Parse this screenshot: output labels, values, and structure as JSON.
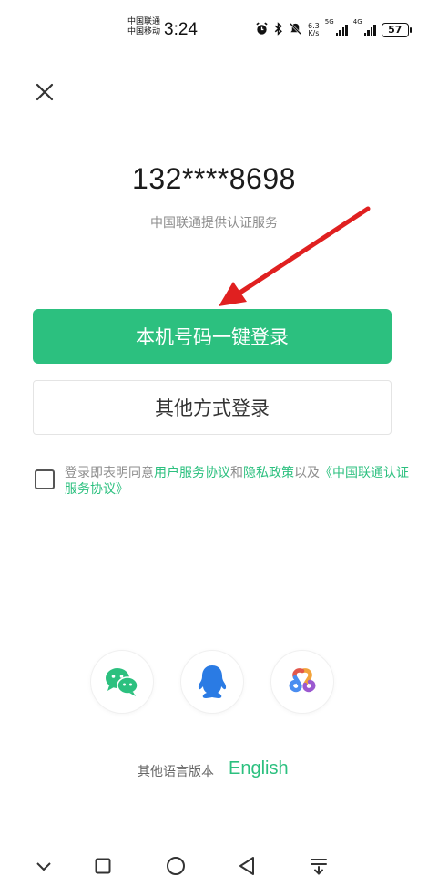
{
  "status_bar": {
    "carrier_1": "中国联通",
    "carrier_2": "中国移动",
    "time": "3:24",
    "net_speed_value": "6.3",
    "net_speed_unit": "K/s",
    "signal_1_label": "5G",
    "signal_2_label": "4G",
    "battery": "57",
    "icons": [
      "alarm-icon",
      "bluetooth-icon",
      "mute-icon"
    ]
  },
  "close_icon": "close-icon",
  "login": {
    "phone_number": "132****8698",
    "provider_text": "中国联通提供认证服务",
    "one_click_button": "本机号码一键登录",
    "other_methods_button": "其他方式登录"
  },
  "agreement": {
    "prefix": "登录即表明同意",
    "user_agreement": "用户服务协议",
    "and": "和",
    "privacy_policy": "隐私政策",
    "and_also": "以及",
    "carrier_agreement": "《中国联通认证服务协议》"
  },
  "social_logins": [
    "wechat-icon",
    "qq-icon",
    "link-icon"
  ],
  "language": {
    "label": "其他语言版本",
    "link": "English"
  },
  "nav_bar": [
    "chevron-down-icon",
    "square-icon",
    "circle-icon",
    "back-triangle-icon",
    "menu-down-icon"
  ],
  "colors": {
    "accent": "#2cc07f",
    "arrow": "#e02020",
    "qq_blue": "#2a7be4"
  }
}
